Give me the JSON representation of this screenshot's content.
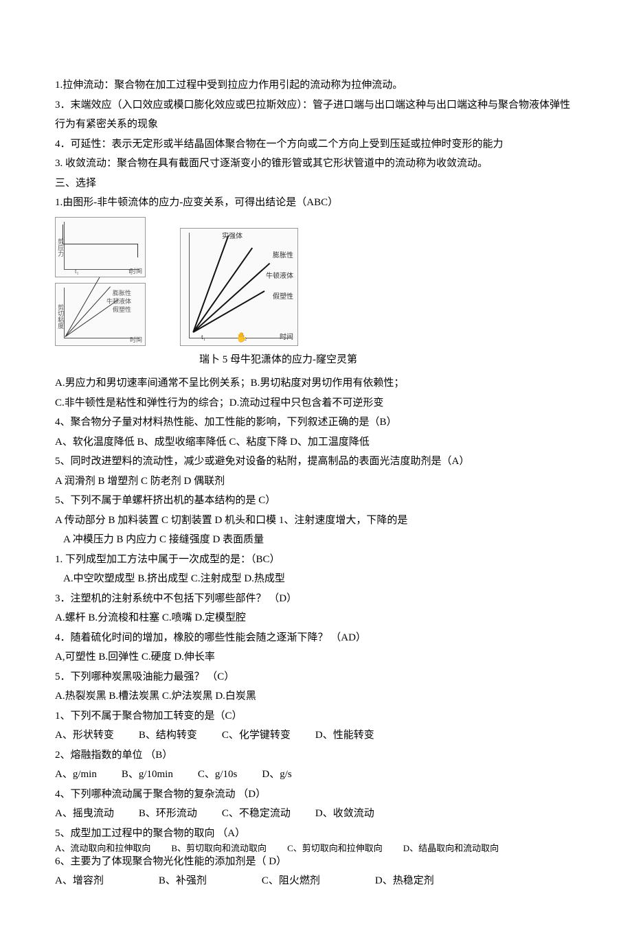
{
  "definitions": {
    "d1": "1.拉伸流动：聚合物在加工过程中受到拉应力作用引起的流动称为拉伸流动。",
    "d2": "3．末端效应（入口效应或模口膨化效应或巴拉斯效应）：管子进口端与出口端这种与出口端这种与聚合物液体弹性行为有紧密关系的现象",
    "d3": "4．可延性：表示无定形或半结晶固体聚合物在一个方向或二个方向上受到压延或拉伸时变形的能力",
    "d4": "3. 收敛流动：聚合物在具有截面尺寸逐渐变小的锥形管或其它形状管道中的流动称为收敛流动。"
  },
  "section_select": "三、选择",
  "q1": {
    "stem": "1.由图形-非牛顿流体的应力-应变关系，可得出结论是（ABC）",
    "figure_labels": {
      "top": "实强体",
      "r1": "膨胀性",
      "r2": "牛顿液体",
      "r3": "假塑性",
      "xaxis": "时间",
      "t1": "t₁",
      "t2": "t₂"
    },
    "hand": "✋",
    "caption": "瑞卜 5 母牛犯潇体的应力-窿空灵第",
    "optAB": "A.男应力和男切速率间通常不呈比例关系；B.男切粘度对男切作用有依赖性；",
    "optCD": "C.非牛顿性是粘性和弹性行为的综合；D.流动过程中只包含着不可逆形变"
  },
  "q4": {
    "stem": "4、聚合物分子量对材料热性能、加工性能的影响，下列叙述正确的是（B）",
    "opts": "A、软化温度降低 B、成型收缩率降低 C、粘度下降 D、加工温度降低"
  },
  "q5a": {
    "stem": "5、同时改进塑料的流动性，减少或避免对设备的粘附，提高制品的表面光洁度助剂是（A）",
    "opts": "A 润滑剂 B 增塑剂 C 防老剂 D 偶联剂"
  },
  "q5b": {
    "stem": "5、下列不属于单螺杆挤出机的基本结构的是 C）",
    "opts": "A 传动部分 B 加料装置 C 切割装置 D 机头和口模  1、注射速度增大，下降的是",
    "sub": "A 冲模压力 B 内应力 C 接缝强度 D 表面质量"
  },
  "qn1": {
    "stem": "1. 下列成型加工方法中属于一次成型的是：（BC）",
    "opts": "A.中空吹塑成型 B.挤出成型 C.注射成型 D.热成型"
  },
  "qn3": {
    "stem": "3．注塑机的注射系统中不包括下列哪些部件？ （D）",
    "opts": "A.螺杆 B.分流梭和柱塞 C.喷嘴 D.定模型腔"
  },
  "qn4": {
    "stem": "4．随着硫化时间的增加，橡胶的哪些性能会随之逐渐下降？  （AD）",
    "opts": "A,可塑性 B.回弹性 C.硬度 D.伸长率"
  },
  "qn5": {
    "stem": "5．下列哪种炭黑吸油能力最强？ （C）",
    "opts": "A.热裂炭黑 B.槽法炭黑 C.炉法炭黑 D.白炭黑"
  },
  "qm1": {
    "stem": "1、下列不属于聚合物加工转变的是（C）",
    "a": "A、形状转变",
    "b": "B、结构转变",
    "c": "C、化学键转变",
    "d": "D、性能转变"
  },
  "qm2": {
    "stem": "2、熔融指数的单位     （B）",
    "a": "A、g/min",
    "b": "B、g/10min",
    "c": "C、g/10s",
    "d": "D、g/s"
  },
  "qm4": {
    "stem": "4、下列哪种流动属于聚合物的复杂流动       （D）",
    "a": "A、摇曳流动",
    "b": "B、环形流动",
    "c": "C、不稳定流动",
    "d": "D、收敛流动"
  },
  "qm5": {
    "stem": "5、成型加工过程中的聚合物的取向    （A）",
    "a": "A、流动取向和拉伸取向",
    "b": "B、剪切取向和流动取向",
    "c": "C、剪切取向和拉伸取向",
    "d": "D、结晶取向和流动取向"
  },
  "qm6": {
    "stem": "6、主要为了体现聚合物光化性能的添加剂是（ D）",
    "a": "A、增容剂",
    "b": "B、补强剂",
    "c": "C、阻火燃剂",
    "d": "D、热稳定剂"
  }
}
